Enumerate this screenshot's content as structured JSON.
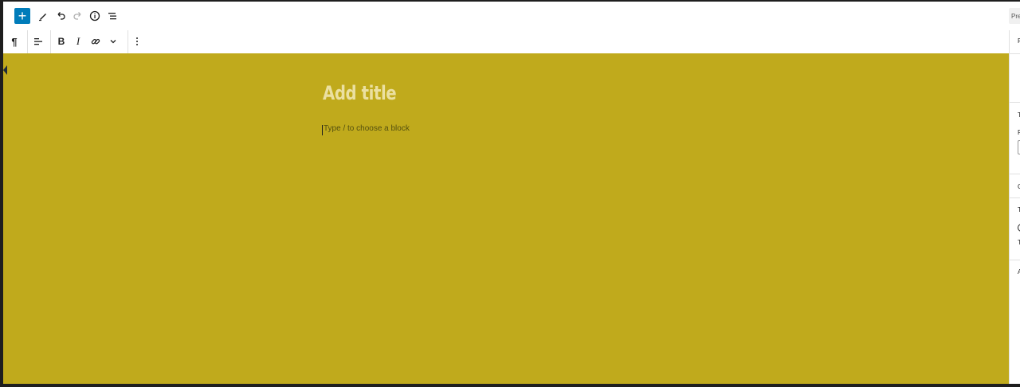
{
  "header": {
    "inserter_icon": "plus-icon",
    "tools": [
      {
        "name": "edit-mode-icon"
      },
      {
        "name": "undo-icon"
      },
      {
        "name": "redo-icon"
      },
      {
        "name": "details-icon"
      },
      {
        "name": "list-view-icon"
      }
    ],
    "preview_label": "Pre"
  },
  "block_toolbar": {
    "paragraph_icon": "pilcrow-icon",
    "align_icon": "align-left-icon",
    "bold_label": "B",
    "italic_label": "I",
    "link_icon": "link-icon",
    "more_rich_icon": "chevron-down-icon",
    "options_icon": "more-vertical-icon"
  },
  "editor": {
    "title_placeholder": "Add title",
    "block_placeholder": "Type / to choose a block",
    "background": "#c0aa1c",
    "title_color": "#ebe0a1",
    "accent": "#007cba"
  },
  "sidebar": {
    "glyphs": [
      "P",
      "T",
      "F",
      "C",
      "T",
      "T",
      "A"
    ]
  }
}
